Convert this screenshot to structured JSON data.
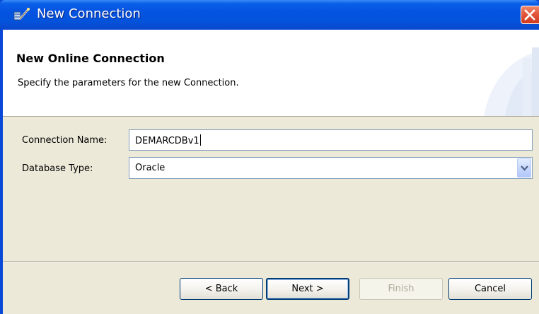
{
  "window": {
    "title": "New Connection"
  },
  "banner": {
    "title": "New Online Connection",
    "description": "Specify the parameters for the new Connection."
  },
  "form": {
    "connection_name_label": "Connection Name:",
    "connection_name_value": "DEMARCDBv1",
    "database_type_label": "Database Type:",
    "database_type_value": "Oracle"
  },
  "buttons": {
    "back": "< Back",
    "next": "Next >",
    "finish": "Finish",
    "cancel": "Cancel"
  },
  "colors": {
    "titlebar": "#0553e1",
    "dialog_background": "#ece9d8",
    "close_button": "#e2573b"
  },
  "icons": {
    "title": "connection-wizard-icon",
    "close": "close-icon",
    "dropdown": "chevron-down-icon"
  }
}
